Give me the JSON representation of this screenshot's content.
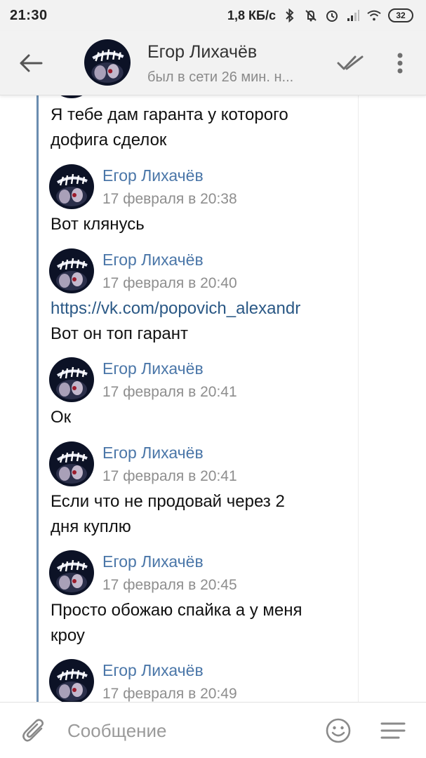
{
  "status_bar": {
    "time": "21:30",
    "speed": "1,8 КБ/с",
    "battery": "32",
    "icons": [
      "bluetooth-icon",
      "mute-icon",
      "alarm-icon",
      "signal-icon",
      "wifi-icon",
      "battery-icon"
    ]
  },
  "header": {
    "name": "Егор Лихачёв",
    "status": "был в сети 26 мин. н...",
    "icons": [
      "back-arrow-icon",
      "double-check-icon",
      "more-vertical-icon"
    ]
  },
  "messages": [
    {
      "text_lines": [
        "Я тебе дам гаранта у которого",
        "дофига сделок"
      ]
    },
    {
      "author": "Егор Лихачёв",
      "time": "17 февраля в 20:38",
      "text_lines": [
        "Вот клянусь"
      ]
    },
    {
      "author": "Егор Лихачёв",
      "time": "17 февраля в 20:40",
      "link": "https://vk.com/popovich_alexandr",
      "text_lines": [
        "Вот он топ гарант"
      ]
    },
    {
      "author": "Егор Лихачёв",
      "time": "17 февраля в 20:41",
      "text_lines": [
        "Ок"
      ]
    },
    {
      "author": "Егор Лихачёв",
      "time": "17 февраля в 20:41",
      "text_lines": [
        "Если что не продовай через 2",
        "дня куплю"
      ]
    },
    {
      "author": "Егор Лихачёв",
      "time": "17 февраля в 20:45",
      "text_lines": [
        "Просто обожаю спайка а у меня",
        "кроу"
      ]
    },
    {
      "author": "Егор Лихачёв",
      "time": "17 февраля в 20:49"
    }
  ],
  "composer": {
    "placeholder": "Сообщение",
    "icons": [
      "paperclip-icon",
      "emoji-icon",
      "menu-lines-icon"
    ]
  },
  "colors": {
    "author": "#4a76a8",
    "link": "#2a5885",
    "quote_line": "#6b8db0",
    "timestamp": "#8e8e8e",
    "bar_bg": "#f2f2f2"
  }
}
